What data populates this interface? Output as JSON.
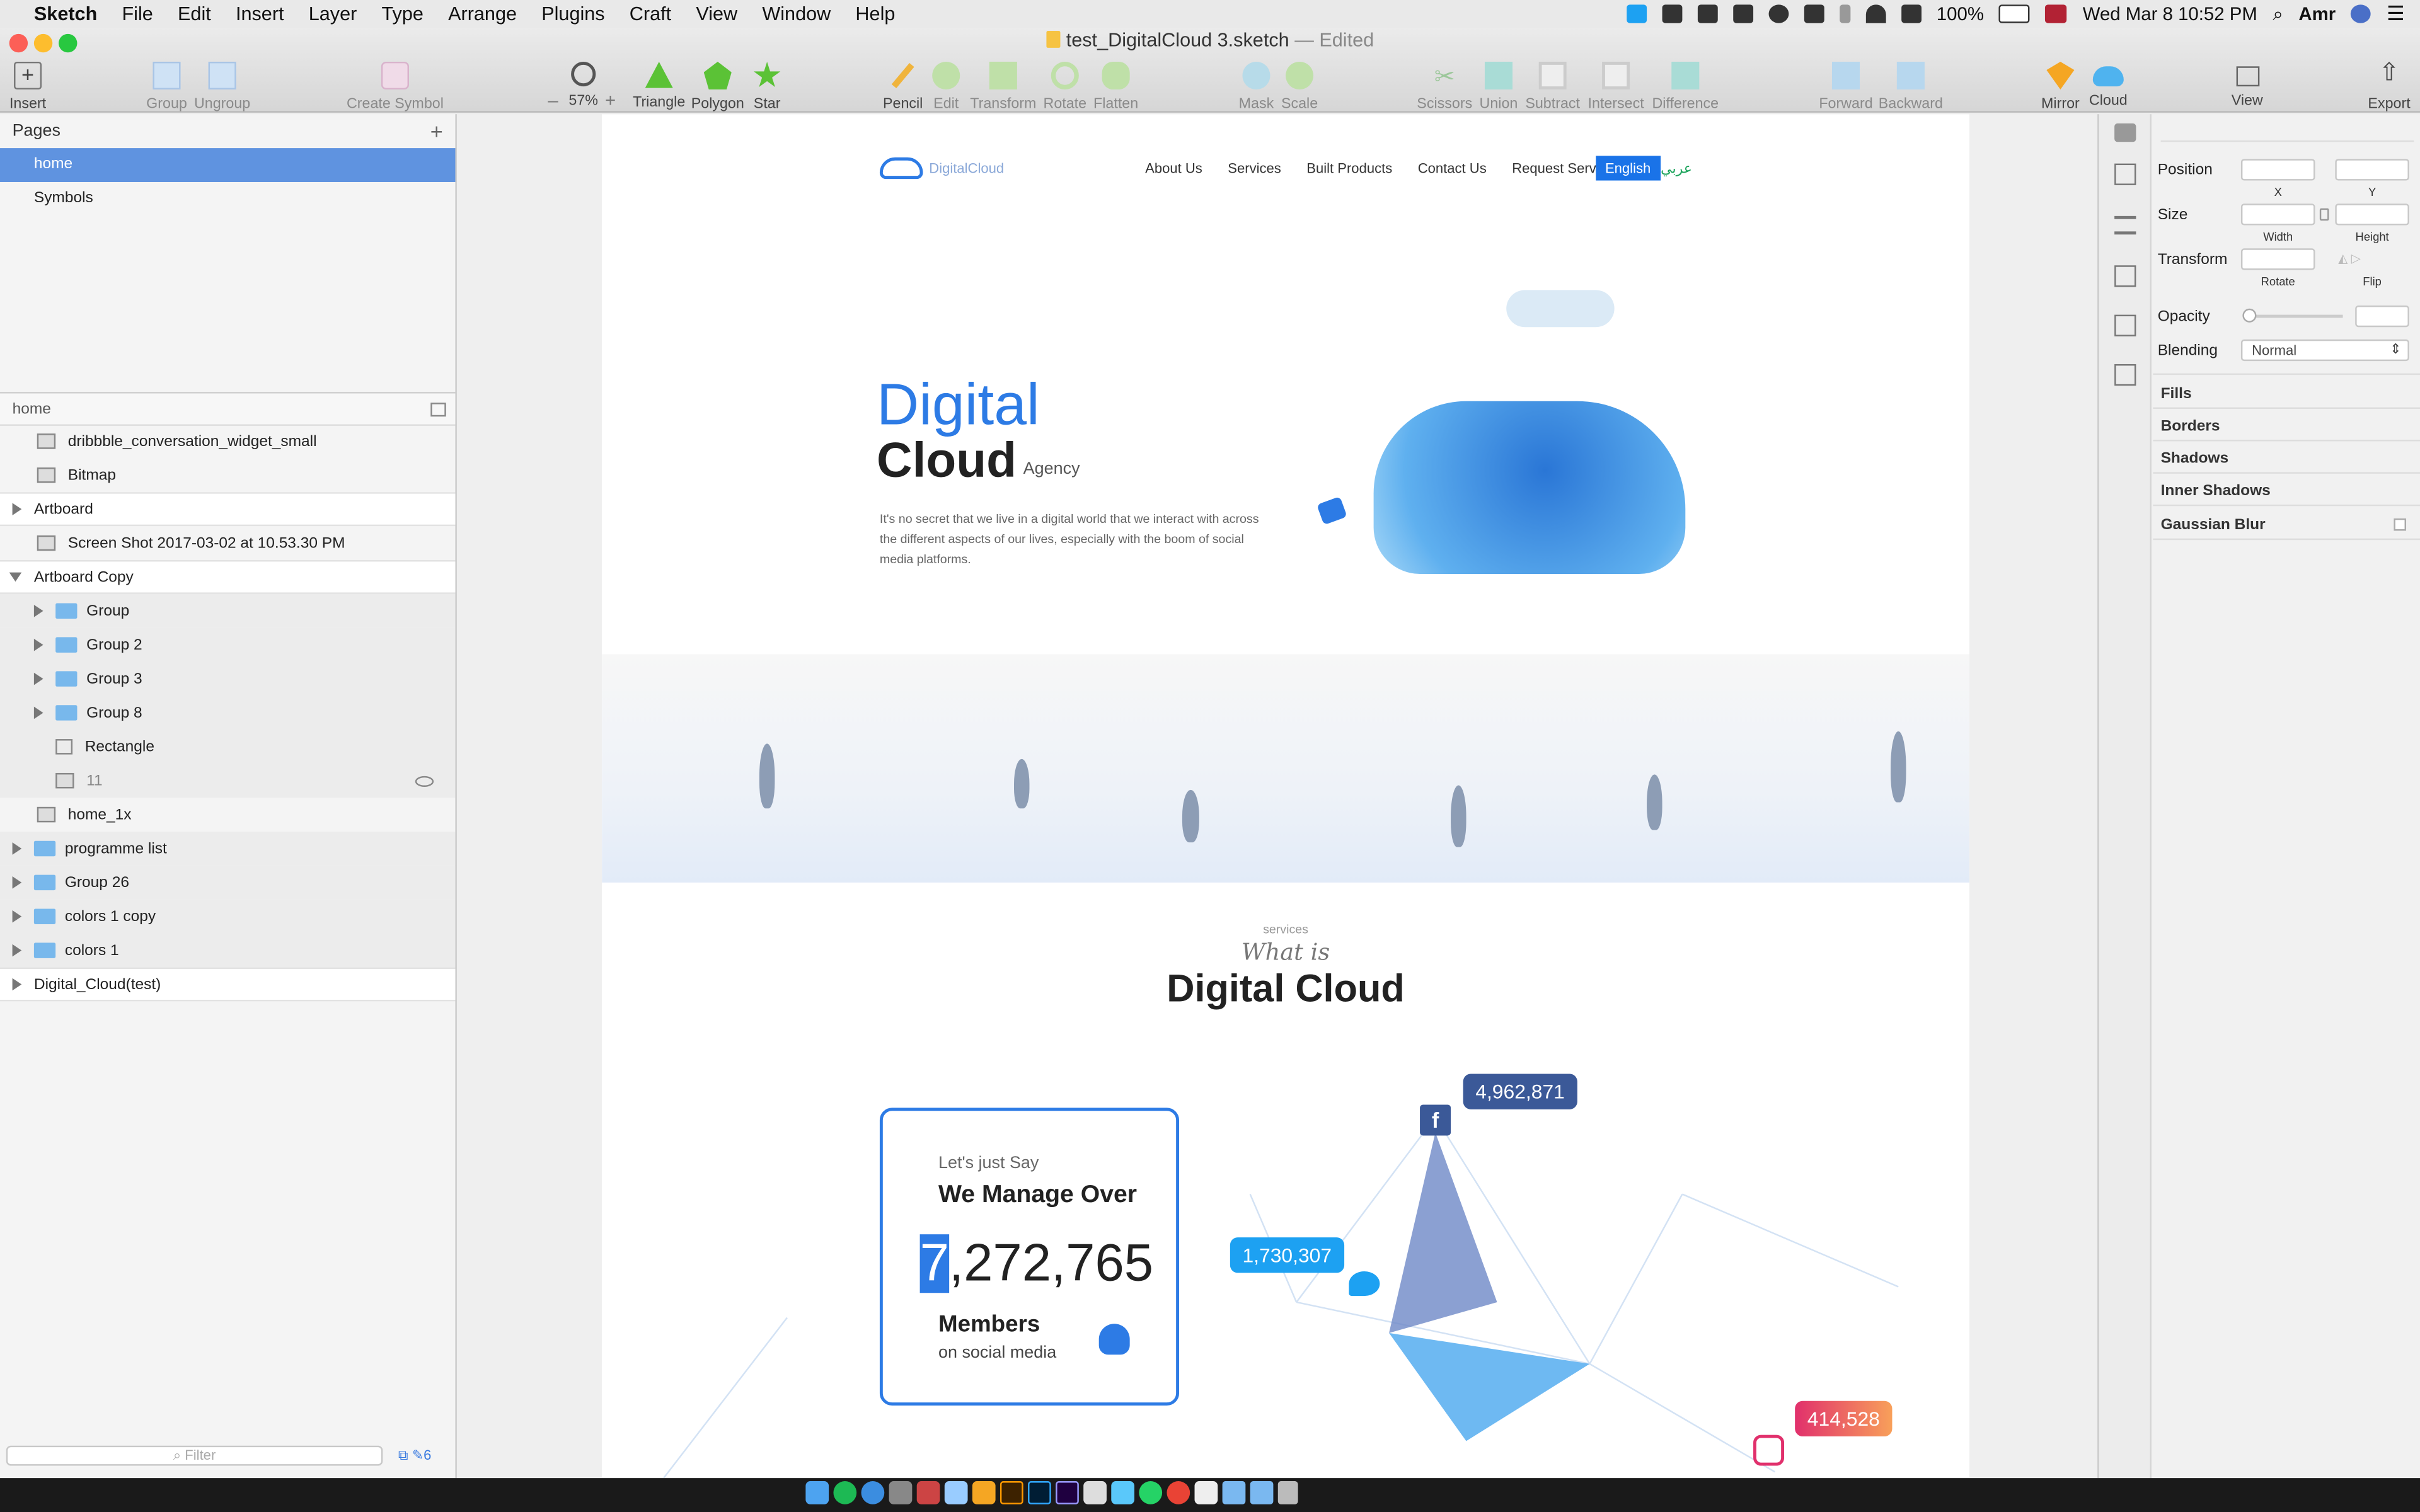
{
  "menubar": {
    "apple": "",
    "items": [
      "Sketch",
      "File",
      "Edit",
      "Insert",
      "Layer",
      "Type",
      "Arrange",
      "Plugins",
      "Craft",
      "View",
      "Window",
      "Help"
    ],
    "battery": "100%",
    "clock": "Wed Mar 8  10:52 PM",
    "user": "Amr"
  },
  "window": {
    "title": "test_DigitalCloud 3.sketch",
    "edited": "— Edited"
  },
  "toolbar": {
    "insert": "Insert",
    "group": "Group",
    "ungroup": "Ungroup",
    "create_symbol": "Create Symbol",
    "zoom": "57%",
    "triangle": "Triangle",
    "polygon": "Polygon",
    "star": "Star",
    "pencil": "Pencil",
    "edit": "Edit",
    "transform": "Transform",
    "rotate": "Rotate",
    "flatten": "Flatten",
    "mask": "Mask",
    "scale": "Scale",
    "scissors": "Scissors",
    "union": "Union",
    "subtract": "Subtract",
    "intersect": "Intersect",
    "difference": "Difference",
    "forward": "Forward",
    "backward": "Backward",
    "mirror": "Mirror",
    "cloud": "Cloud",
    "view": "View",
    "export": "Export"
  },
  "pages": {
    "header": "Pages",
    "items": [
      "home",
      "Symbols"
    ]
  },
  "layers": {
    "page_name": "home",
    "items": [
      "dribbble_conversation_widget_small",
      "Bitmap",
      "Artboard",
      "Screen Shot 2017-03-02 at 10.53.30 PM",
      "Artboard Copy",
      "Group",
      "Group 2",
      "Group 3",
      "Group 8",
      "Rectangle",
      "11",
      "home_1x",
      "programme list",
      "Group 26",
      "colors 1 copy",
      "colors 1",
      "Digital_Cloud(test)"
    ],
    "filter_placeholder": "Filter",
    "filter_count": "6"
  },
  "site": {
    "logo": "DigitalCloud",
    "nav": [
      "About Us",
      "Services",
      "Built Products",
      "Contact Us",
      "Request Service"
    ],
    "lang_en": "English",
    "lang_ar": "عربي",
    "hero_word1": "Digital",
    "hero_word2": "Cloud",
    "hero_agency": "Agency",
    "hero_text": "It's no secret that we live in a digital world that we interact with across the different aspects of our lives, especially with the boom of social media platforms.",
    "services_kicker": "services",
    "services_script": "What is",
    "services_title": "Digital Cloud",
    "card_intro": "Let's just Say",
    "card_heading": "We Manage Over",
    "card_number_first": "7",
    "card_number_rest": ",272,765",
    "card_members": "Members",
    "card_sub": "on social media",
    "stat_facebook": "4,962,871",
    "stat_twitter": "1,730,307",
    "stat_instagram": "414,528"
  },
  "inspector": {
    "position": "Position",
    "x": "X",
    "y": "Y",
    "size": "Size",
    "width": "Width",
    "height": "Height",
    "transform": "Transform",
    "rotate": "Rotate",
    "flip": "Flip",
    "opacity": "Opacity",
    "blending": "Blending",
    "blending_value": "Normal",
    "fills": "Fills",
    "borders": "Borders",
    "shadows": "Shadows",
    "inner_shadows": "Inner Shadows",
    "gaussian_blur": "Gaussian Blur"
  },
  "colors": {
    "selection": "#5f93e0",
    "brand_blue": "#1a73e8",
    "card_border": "#2d7be5",
    "facebook_bubble": "#3b5998",
    "twitter_bubble": "#1da1f2",
    "instagram_bubble": "#f06a5a"
  }
}
